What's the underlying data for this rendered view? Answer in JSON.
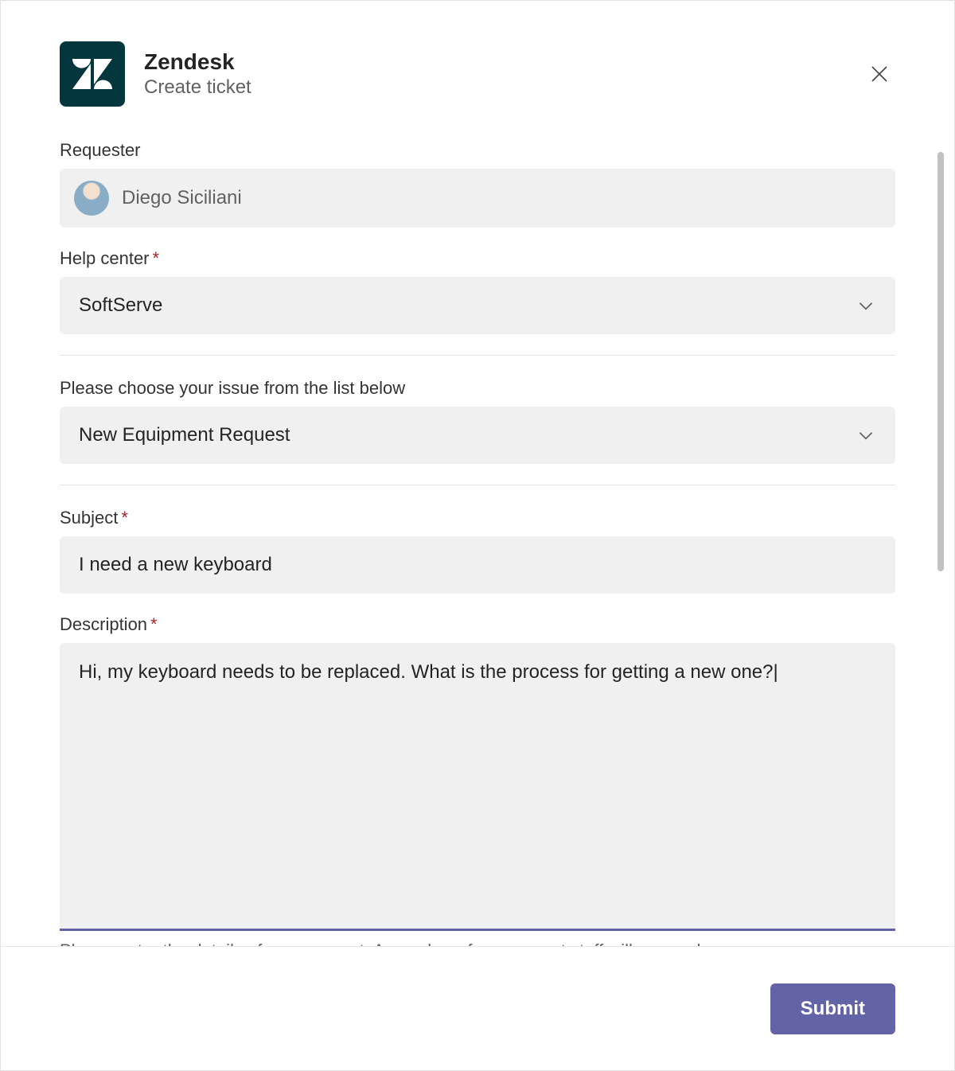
{
  "header": {
    "app_name": "Zendesk",
    "subtitle": "Create ticket"
  },
  "form": {
    "requester": {
      "label": "Requester",
      "value": "Diego Siciliani"
    },
    "help_center": {
      "label": "Help center",
      "required": true,
      "value": "SoftServe"
    },
    "issue": {
      "label": "Please choose your issue from the list below",
      "value": "New Equipment Request"
    },
    "subject": {
      "label": "Subject",
      "required": true,
      "value": "I need a new keyboard"
    },
    "description": {
      "label": "Description",
      "required": true,
      "value": "Hi, my keyboard needs to be replaced. What is the process for getting a new one?",
      "help_text": "Please enter the details of your request. A member of our support staff will respond as soon as"
    }
  },
  "footer": {
    "submit_label": "Submit"
  },
  "colors": {
    "brand_accent": "#6264a7",
    "app_icon_bg": "#03363d"
  }
}
